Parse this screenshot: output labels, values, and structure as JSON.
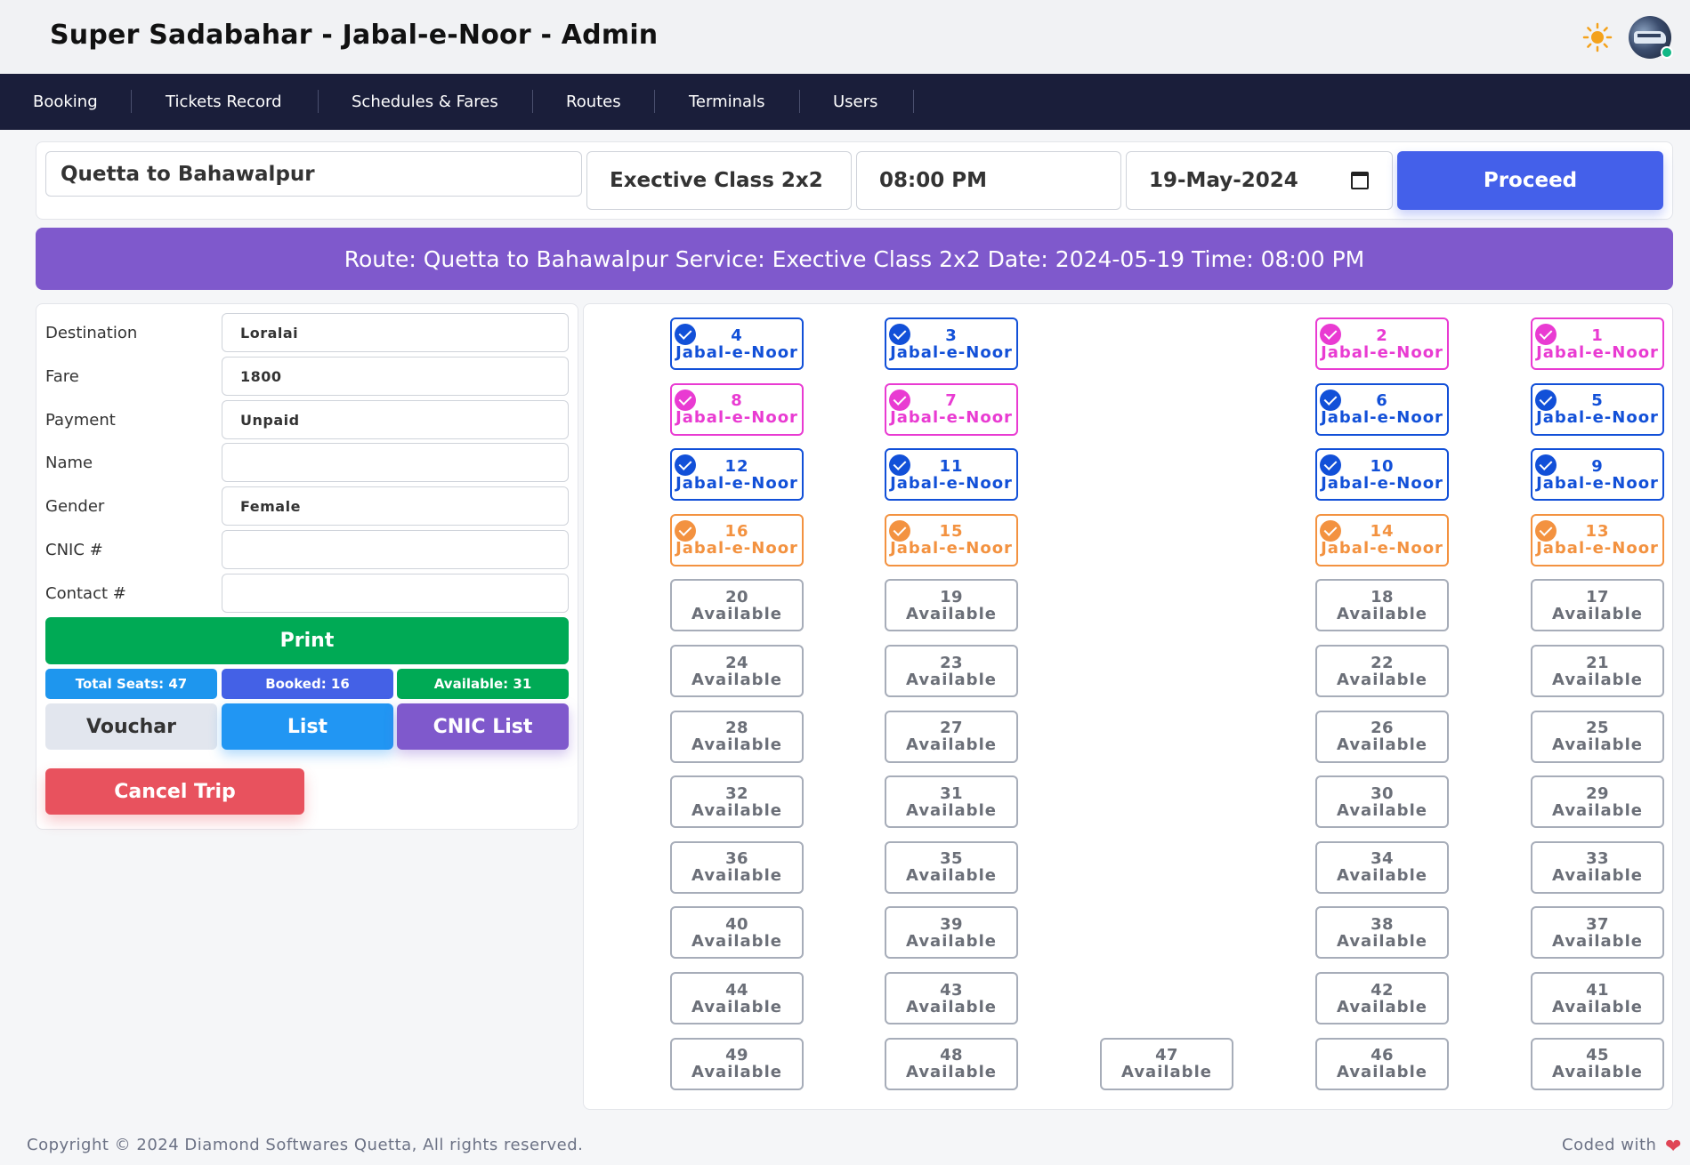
{
  "app": {
    "title": "Super Sadabahar - Jabal-e-Noor - Admin"
  },
  "header_icons": {
    "theme_icon": "sun-icon",
    "avatar": "user-avatar"
  },
  "nav": {
    "items": [
      "Booking",
      "Tickets Record",
      "Schedules & Fares",
      "Routes",
      "Terminals",
      "Users"
    ]
  },
  "search": {
    "route": "Quetta to Bahawalpur",
    "service": "Exective Class 2x2",
    "time": "08:00 PM",
    "date": "19-May-2024",
    "proceed_label": "Proceed"
  },
  "banner": {
    "text": "Route: Quetta to Bahawalpur Service: Exective Class 2x2 Date: 2024-05-19 Time: 08:00 PM"
  },
  "form": {
    "fields": [
      {
        "label": "Destination",
        "value": "Loralai"
      },
      {
        "label": "Fare",
        "value": "1800"
      },
      {
        "label": "Payment",
        "value": "Unpaid"
      },
      {
        "label": "Name",
        "value": ""
      },
      {
        "label": "Gender",
        "value": "Female"
      },
      {
        "label": "CNIC #",
        "value": ""
      },
      {
        "label": "Contact #",
        "value": ""
      }
    ],
    "print_label": "Print",
    "stats": {
      "total": "Total Seats: 47",
      "booked": "Booked: 16",
      "available": "Available: 31"
    },
    "vouchar_label": "Vouchar",
    "list_label": "List",
    "cnic_list_label": "CNIC List",
    "cancel_label": "Cancel Trip"
  },
  "colors": {
    "blue": "#1250d8",
    "pink": "#e93bd2",
    "orange": "#f39240",
    "available": "#6b6f78",
    "nav_bg": "#1a1e3a",
    "banner": "#7f59cc",
    "proceed": "#4460ea"
  },
  "seats": {
    "rows": [
      [
        {
          "n": "4",
          "s": "Jabal-e-Noor",
          "c": "blue"
        },
        {
          "n": "3",
          "s": "Jabal-e-Noor",
          "c": "blue"
        },
        null,
        {
          "n": "2",
          "s": "Jabal-e-Noor",
          "c": "pink"
        },
        {
          "n": "1",
          "s": "Jabal-e-Noor",
          "c": "pink"
        }
      ],
      [
        {
          "n": "8",
          "s": "Jabal-e-Noor",
          "c": "pink"
        },
        {
          "n": "7",
          "s": "Jabal-e-Noor",
          "c": "pink"
        },
        null,
        {
          "n": "6",
          "s": "Jabal-e-Noor",
          "c": "blue"
        },
        {
          "n": "5",
          "s": "Jabal-e-Noor",
          "c": "blue"
        }
      ],
      [
        {
          "n": "12",
          "s": "Jabal-e-Noor",
          "c": "blue"
        },
        {
          "n": "11",
          "s": "Jabal-e-Noor",
          "c": "blue"
        },
        null,
        {
          "n": "10",
          "s": "Jabal-e-Noor",
          "c": "blue"
        },
        {
          "n": "9",
          "s": "Jabal-e-Noor",
          "c": "blue"
        }
      ],
      [
        {
          "n": "16",
          "s": "Jabal-e-Noor",
          "c": "orange"
        },
        {
          "n": "15",
          "s": "Jabal-e-Noor",
          "c": "orange"
        },
        null,
        {
          "n": "14",
          "s": "Jabal-e-Noor",
          "c": "orange"
        },
        {
          "n": "13",
          "s": "Jabal-e-Noor",
          "c": "orange"
        }
      ],
      [
        {
          "n": "20",
          "s": "Available",
          "c": "available"
        },
        {
          "n": "19",
          "s": "Available",
          "c": "available"
        },
        null,
        {
          "n": "18",
          "s": "Available",
          "c": "available"
        },
        {
          "n": "17",
          "s": "Available",
          "c": "available"
        }
      ],
      [
        {
          "n": "24",
          "s": "Available",
          "c": "available"
        },
        {
          "n": "23",
          "s": "Available",
          "c": "available"
        },
        null,
        {
          "n": "22",
          "s": "Available",
          "c": "available"
        },
        {
          "n": "21",
          "s": "Available",
          "c": "available"
        }
      ],
      [
        {
          "n": "28",
          "s": "Available",
          "c": "available"
        },
        {
          "n": "27",
          "s": "Available",
          "c": "available"
        },
        null,
        {
          "n": "26",
          "s": "Available",
          "c": "available"
        },
        {
          "n": "25",
          "s": "Available",
          "c": "available"
        }
      ],
      [
        {
          "n": "32",
          "s": "Available",
          "c": "available"
        },
        {
          "n": "31",
          "s": "Available",
          "c": "available"
        },
        null,
        {
          "n": "30",
          "s": "Available",
          "c": "available"
        },
        {
          "n": "29",
          "s": "Available",
          "c": "available"
        }
      ],
      [
        {
          "n": "36",
          "s": "Available",
          "c": "available"
        },
        {
          "n": "35",
          "s": "Available",
          "c": "available"
        },
        null,
        {
          "n": "34",
          "s": "Available",
          "c": "available"
        },
        {
          "n": "33",
          "s": "Available",
          "c": "available"
        }
      ],
      [
        {
          "n": "40",
          "s": "Available",
          "c": "available"
        },
        {
          "n": "39",
          "s": "Available",
          "c": "available"
        },
        null,
        {
          "n": "38",
          "s": "Available",
          "c": "available"
        },
        {
          "n": "37",
          "s": "Available",
          "c": "available"
        }
      ],
      [
        {
          "n": "44",
          "s": "Available",
          "c": "available"
        },
        {
          "n": "43",
          "s": "Available",
          "c": "available"
        },
        null,
        {
          "n": "42",
          "s": "Available",
          "c": "available"
        },
        {
          "n": "41",
          "s": "Available",
          "c": "available"
        }
      ],
      [
        {
          "n": "49",
          "s": "Available",
          "c": "available"
        },
        {
          "n": "48",
          "s": "Available",
          "c": "available"
        },
        {
          "n": "47",
          "s": "Available",
          "c": "available"
        },
        {
          "n": "46",
          "s": "Available",
          "c": "available"
        },
        {
          "n": "45",
          "s": "Available",
          "c": "available"
        }
      ]
    ]
  },
  "footer": {
    "copyright": "Copyright © 2024 Diamond Softwares Quetta, All rights reserved.",
    "coded": "Coded with"
  }
}
